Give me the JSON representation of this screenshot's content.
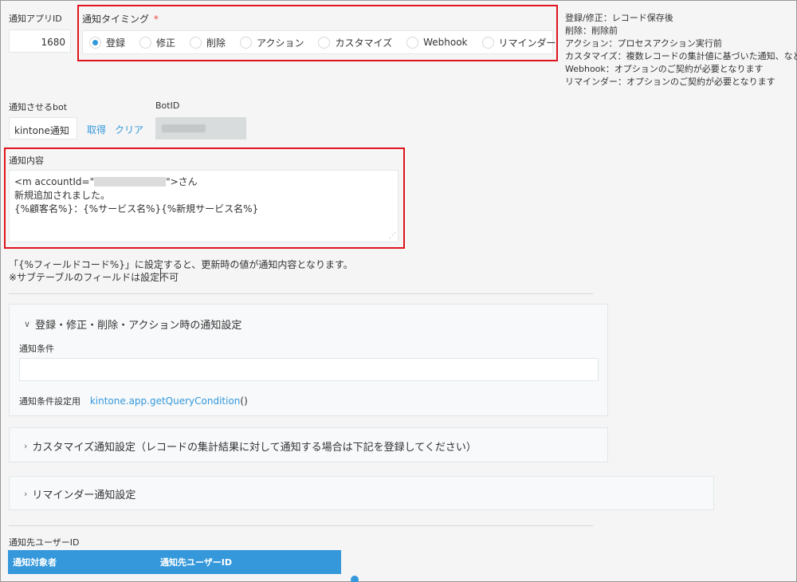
{
  "app_id": {
    "label": "通知アプリID",
    "value": "1680"
  },
  "timing": {
    "label": "通知タイミング",
    "required_mark": "*",
    "options": [
      {
        "label": "登録",
        "selected": true
      },
      {
        "label": "修正",
        "selected": false
      },
      {
        "label": "削除",
        "selected": false
      },
      {
        "label": "アクション",
        "selected": false
      },
      {
        "label": "カスタマイズ",
        "selected": false
      },
      {
        "label": "Webhook",
        "selected": false
      },
      {
        "label": "リマインダー",
        "selected": false
      }
    ]
  },
  "timing_notes": [
    "登録/修正：レコード保存後",
    "削除：削除前",
    "アクション：プロセスアクション実行前",
    "カスタマイズ：複数レコードの集計値に基づいた通知、など",
    "Webhook：オプションのご契約が必要となります",
    "リマインダー：オプションのご契約が必要となります"
  ],
  "bot": {
    "label": "通知させるbot",
    "value": "kintone通知",
    "get_link": "取得",
    "clear_link": "クリア",
    "botid_label": "BotID"
  },
  "content": {
    "label": "通知内容",
    "line1_prefix": "<m accountId=\"",
    "line1_suffix": "\">さん",
    "line2": "新規追加されました。",
    "line3": "{%顧客名%}：{%サービス名%}{%新規サービス名%}"
  },
  "help": {
    "line1": "「{%フィールドコード%}」に設定すると、更新時の値が通知内容となります。",
    "line2": "※サブテーブルのフィールドは設定不可"
  },
  "section_register": {
    "title": "登録・修正・削除・アクション時の通知設定",
    "condition_label": "通知条件",
    "condition_value": "",
    "condition_helper_label": "通知条件設定用",
    "condition_helper_link": "kintone.app.getQueryCondition",
    "condition_helper_suffix": "()"
  },
  "section_customize": {
    "title": "カスタマイズ通知設定（レコードの集計結果に対して通知する場合は下記を登録してください）"
  },
  "section_reminder": {
    "title": "リマインダー通知設定"
  },
  "recipients": {
    "label": "通知先ユーザーID",
    "columns": [
      "通知対象者",
      "通知先ユーザーID"
    ]
  },
  "colors": {
    "accent": "#3498db",
    "highlight": "#e0141e",
    "required": "#e74c3c"
  }
}
